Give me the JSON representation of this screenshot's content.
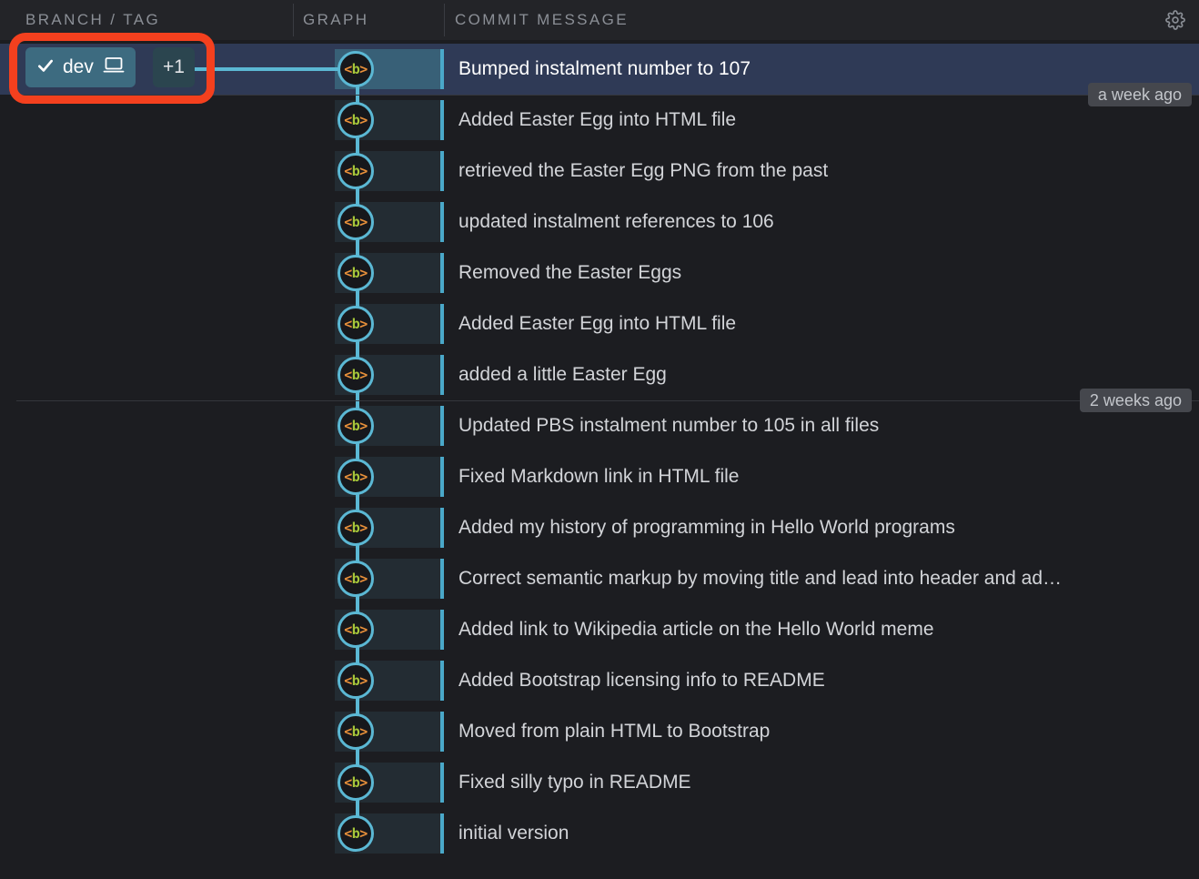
{
  "header": {
    "columns": [
      {
        "label": "BRANCH / TAG"
      },
      {
        "label": "GRAPH"
      },
      {
        "label": "COMMIT MESSAGE"
      }
    ],
    "settings_icon": "gear-icon"
  },
  "branch": {
    "check_icon": "check-icon",
    "name": "dev",
    "local_icon": "laptop-icon",
    "extra_count": "+1"
  },
  "node": {
    "left_bracket": "<",
    "letter": "b",
    "right_bracket": ">"
  },
  "colors": {
    "accent_blue": "#5bb8d4",
    "selected_row": "#2f3a56",
    "row_bg": "#1c1d21",
    "header_bg": "#232428",
    "branch_badge": "#3d6b80",
    "annotation_red": "#f4401e",
    "node_bracket": "#e8903a",
    "node_letter": "#a6c63a"
  },
  "commits": [
    {
      "message": "Bumped instalment number to 107",
      "selected": true
    },
    {
      "message": "Added Easter Egg into HTML file",
      "selected": false
    },
    {
      "message": "retrieved the Easter Egg PNG from the past",
      "selected": false
    },
    {
      "message": "updated instalment references to 106",
      "selected": false
    },
    {
      "message": "Removed the Easter Eggs",
      "selected": false
    },
    {
      "message": "Added Easter Egg into HTML file",
      "selected": false
    },
    {
      "message": "added a little Easter Egg",
      "selected": false
    },
    {
      "message": "Updated PBS instalment number to 105 in all files",
      "selected": false
    },
    {
      "message": "Fixed Markdown link in HTML file",
      "selected": false
    },
    {
      "message": "Added my history of programming in Hello World programs",
      "selected": false
    },
    {
      "message": "Correct semantic markup by moving title and lead into header and ad…",
      "selected": false
    },
    {
      "message": "Added link to Wikipedia article on the Hello World meme",
      "selected": false
    },
    {
      "message": "Added Bootstrap licensing info to README",
      "selected": false
    },
    {
      "message": "Moved from plain HTML to Bootstrap",
      "selected": false
    },
    {
      "message": "Fixed silly typo in README",
      "selected": false
    },
    {
      "message": "initial version",
      "selected": false
    }
  ],
  "date_groups": [
    {
      "label": "a week ago",
      "after_row": 0
    },
    {
      "label": "2 weeks ago",
      "after_row": 6
    }
  ]
}
